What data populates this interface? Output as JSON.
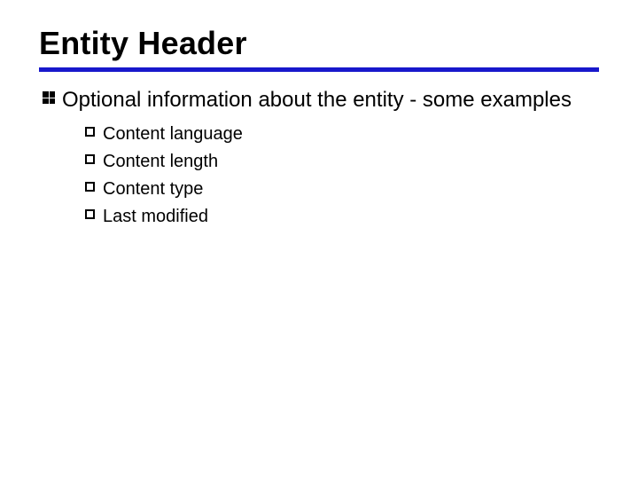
{
  "slide": {
    "title": "Entity Header",
    "bullet": {
      "text": "Optional information about the entity - some examples",
      "subitems": [
        "Content language",
        "Content length",
        "Content type",
        "Last modified"
      ]
    }
  },
  "colors": {
    "rule": "#1818cc"
  }
}
